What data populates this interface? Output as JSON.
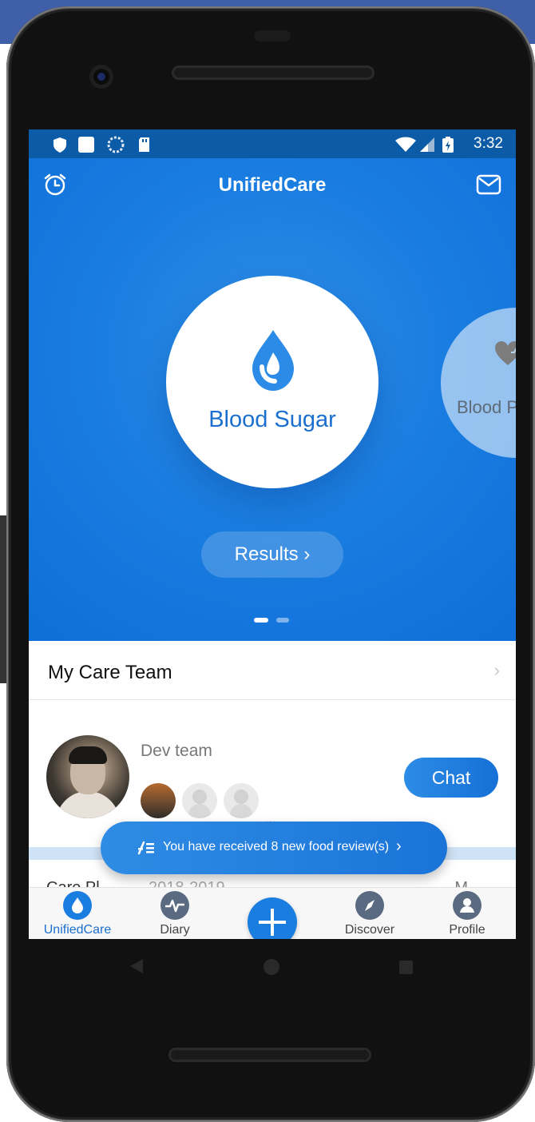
{
  "statusbar": {
    "time": "3:32",
    "icons": [
      "shield-icon",
      "square-icon",
      "sync-icon",
      "sdcard-icon",
      "wifi-icon",
      "signal-icon",
      "battery-charging-icon"
    ]
  },
  "header": {
    "title": "UnifiedCare",
    "left_icon": "alarm-clock-icon",
    "right_icon": "mail-icon"
  },
  "carousel": {
    "active_label": "Blood Sugar",
    "next_label": "Blood P",
    "results_label": "Results ›",
    "page_count": 2,
    "active_page": 1
  },
  "care_team": {
    "title": "My Care Team",
    "team_name": "Dev team",
    "chat_label": "Chat",
    "more": "..."
  },
  "care_plan": {
    "label": "Care Pl",
    "year": "2018-2019",
    "more": "M"
  },
  "toast": {
    "text": "You have received 8 new food review(s)"
  },
  "tabs": [
    {
      "label": "UnifiedCare",
      "icon": "drop-icon",
      "active": true
    },
    {
      "label": "Diary",
      "icon": "pulse-icon",
      "active": false
    },
    {
      "label": "",
      "icon": "plus-icon",
      "active": false
    },
    {
      "label": "Discover",
      "icon": "compass-icon",
      "active": false
    },
    {
      "label": "Profile",
      "icon": "person-icon",
      "active": false
    }
  ],
  "colors": {
    "primary": "#1a7de0",
    "statusbar": "#0b5ba6",
    "text_blue": "#1a6fcf"
  }
}
